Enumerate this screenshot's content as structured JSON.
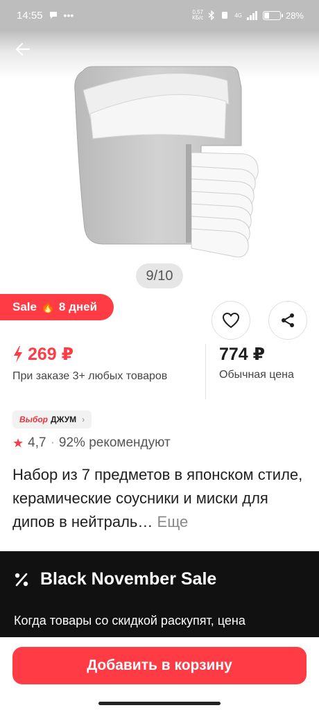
{
  "status_bar": {
    "time": "14:55",
    "net_speed_value": "0,57",
    "net_speed_unit": "КБ/с",
    "network": "4G",
    "battery": "28%"
  },
  "gallery": {
    "pager": "9/10"
  },
  "sale_badge": {
    "label": "Sale",
    "days": "8 дней"
  },
  "price": {
    "bulk_price": "269 ₽",
    "bulk_note": "При заказе 3+ любых товаров",
    "regular_price": "774 ₽",
    "regular_note": "Обычная цена"
  },
  "choice_chip": {
    "brand_a": "Выбор",
    "brand_b": "ДЖУМ"
  },
  "rating": {
    "score": "4,7",
    "recommend": "92% рекомендуют"
  },
  "product": {
    "title": "Набор из 7 предметов в японском стиле, керамические соусники и миски для дипов в нейтраль…",
    "more": "Еще"
  },
  "promo": {
    "title": "Black November Sale",
    "text": "Когда товары со скидкой раскупят, цена"
  },
  "bottom_bar": {
    "cart_button": "Добавить в корзину"
  },
  "colors": {
    "accent": "#ff3b45",
    "promo_bg": "#111111"
  }
}
